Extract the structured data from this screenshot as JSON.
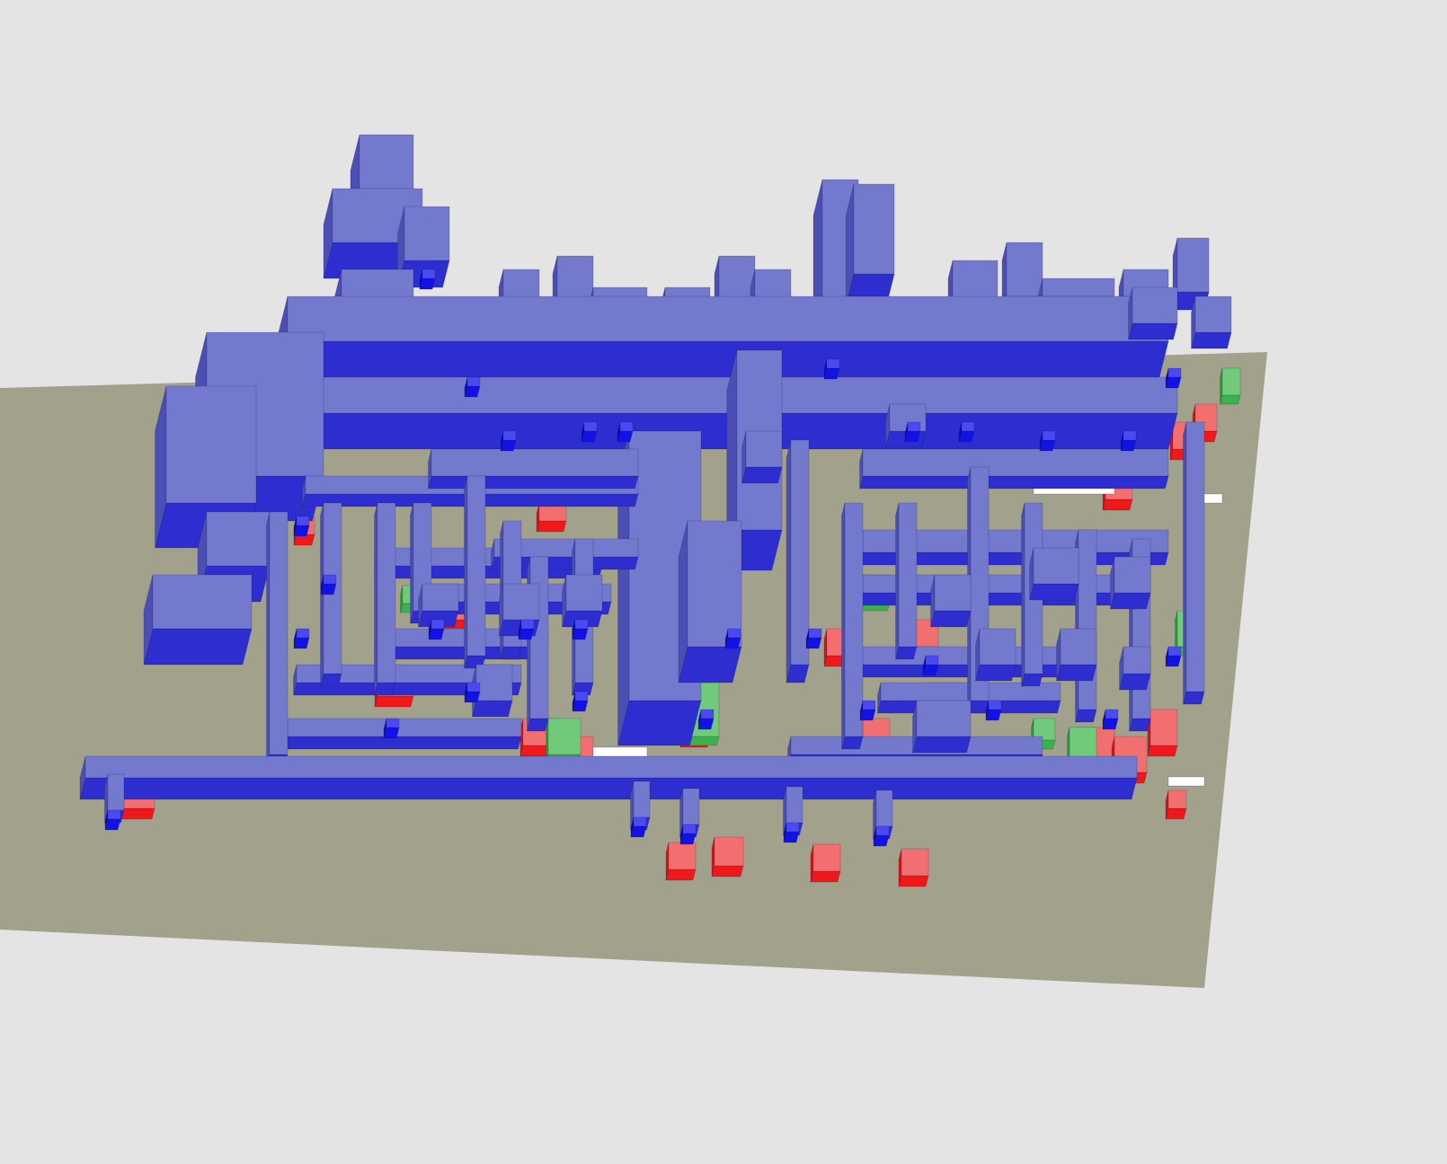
{
  "viewer": {
    "background_color": "#e4e4e4",
    "ground_color": "#a2a18b",
    "colors": {
      "metal_top": "#7379cc",
      "metal_front": "#2d2dd0",
      "metal_side": "#4b4fb4",
      "metal_dark": "#3a3d9c",
      "via": "#1212e6",
      "contact_red": "#f01818",
      "contact_red_light": "#f26f6f",
      "diffusion_green": "#3bb24a",
      "pad_white": "#ffffff"
    }
  }
}
